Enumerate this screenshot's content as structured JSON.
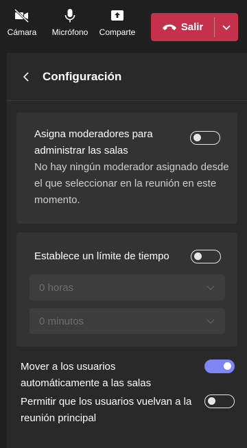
{
  "toolbar": {
    "camera_label": "Cámara",
    "camera_icon": "camera-off-icon",
    "mic_label": "Micrófono",
    "mic_icon": "microphone-icon",
    "share_label": "Comparte",
    "share_icon": "share-screen-icon",
    "leave_label": "Salir",
    "leave_icon": "phone-hangup-icon"
  },
  "panel": {
    "title": "Configuración"
  },
  "moderators": {
    "label": "Asigna moderadores para administrar las salas",
    "description": "No hay ningún moderador asignado desde el que seleccionar en la reunión en este momento.",
    "enabled": false
  },
  "time_limit": {
    "label": "Establece un límite de tiempo",
    "enabled": false,
    "hours_value": "0 horas",
    "minutes_value": "0 minutos"
  },
  "auto_move": {
    "label": "Mover a los usuarios automáticamente a las salas",
    "enabled": true
  },
  "return_main": {
    "label": "Permitir que los usuarios vuelvan a la reunión principal",
    "enabled": false
  },
  "colors": {
    "leave_red": "#c4314b",
    "toggle_on": "#7f85f5",
    "panel_bg": "#292929",
    "card_bg": "#333333"
  }
}
